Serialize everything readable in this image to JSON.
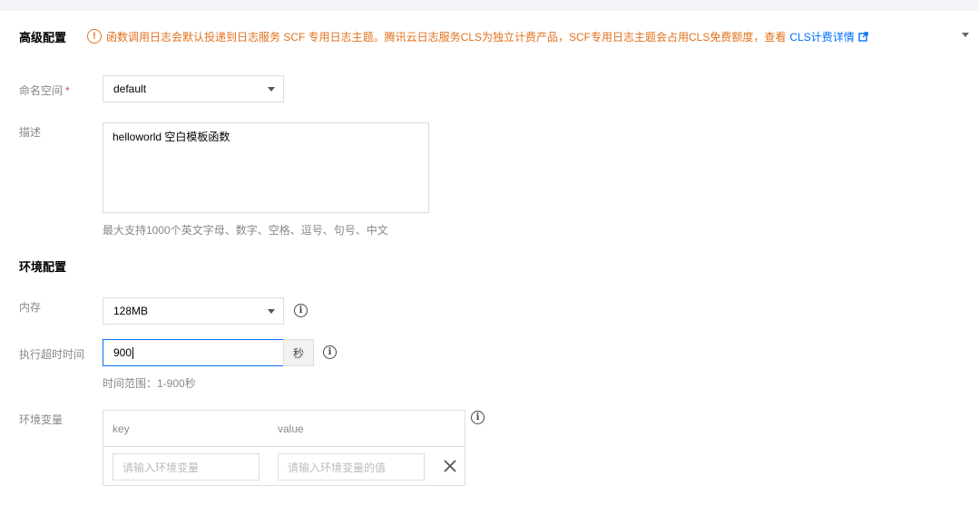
{
  "advanced": {
    "title": "高级配置",
    "notice": {
      "text": "函数调用日志会默认投递到日志服务 SCF 专用日志主题。腾讯云日志服务CLS为独立计费产品，SCF专用日志主题会占用CLS免费额度，查看",
      "link_label": "CLS计费详情"
    }
  },
  "namespace": {
    "label": "命名空间",
    "required_mark": "*",
    "value": "default"
  },
  "description": {
    "label": "描述",
    "value": "helloworld 空白模板函数",
    "hint": "最大支持1000个英文字母、数字、空格、逗号、句号、中文"
  },
  "env_config": {
    "title": "环境配置",
    "memory": {
      "label": "内存",
      "value": "128MB"
    },
    "timeout": {
      "label": "执行超时时间",
      "value": "900",
      "unit": "秒",
      "hint": "时间范围：1-900秒"
    },
    "env_vars": {
      "label": "环境变量",
      "col_key": "key",
      "col_value": "value",
      "key_placeholder": "请输入环境变量",
      "value_placeholder": "请输入环境变量的值"
    }
  },
  "colors": {
    "warning": "#e2711d",
    "link": "#006eff",
    "focus_border": "#006eff"
  },
  "icons": {
    "warning": "warning-circle-icon",
    "external": "external-link-icon",
    "info": "info-icon",
    "delete": "close-icon"
  }
}
